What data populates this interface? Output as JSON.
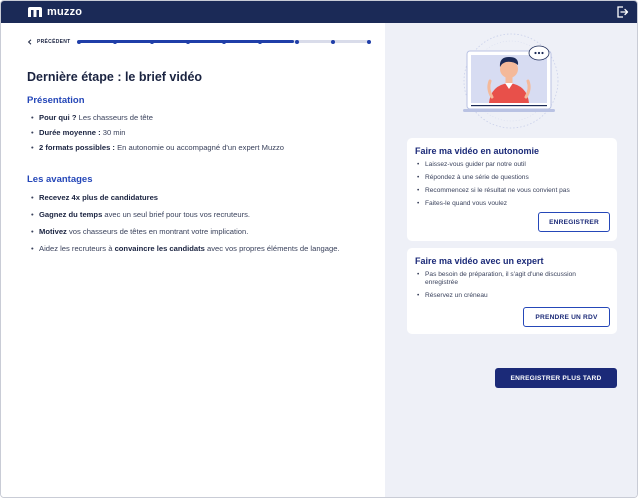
{
  "brand": {
    "name": "muzzo"
  },
  "nav": {
    "back_label": "PRÉCÉDENT"
  },
  "progress": {
    "fraction": 0.74,
    "steps": 9
  },
  "page": {
    "title": "Dernière étape : le brief vidéo"
  },
  "presentation": {
    "title": "Présentation",
    "items": [
      {
        "label": "Pour qui ?",
        "text": " Les chasseurs de tête"
      },
      {
        "label": "Durée moyenne :",
        "text": " 30 min"
      },
      {
        "label": "2 formats possibles :",
        "text": " En autonomie ou accompagné d'un expert Muzzo"
      }
    ]
  },
  "advantages": {
    "title": "Les avantages",
    "items": [
      {
        "pre": "",
        "label": "Recevez 4x plus de candidatures",
        "post": ""
      },
      {
        "pre": "",
        "label": "Gagnez du temps",
        "post": " avec un seul brief pour tous vos recruteurs."
      },
      {
        "pre": "",
        "label": "Motivez",
        "post": " vos chasseurs de têtes en montrant votre implication."
      },
      {
        "pre": "Aidez les recruteurs à ",
        "label": "convaincre les candidats",
        "post": " avec vos propres éléments de langage."
      }
    ]
  },
  "card_auto": {
    "title": "Faire ma vidéo en autonomie",
    "items": [
      "Laissez-vous guider par notre outil",
      "Répondez à une série de questions",
      "Recommencez si le résultat ne vous convient pas",
      "Faites-le quand vous voulez"
    ],
    "button": "ENREGISTRER"
  },
  "card_expert": {
    "title": "Faire ma vidéo avec un expert",
    "items": [
      "Pas besoin de préparation, il s'agit d'une discussion enregistrée",
      "Réservez un créneau"
    ],
    "button": "PRENDRE UN RDV"
  },
  "later_button": "ENREGISTRER PLUS TARD",
  "colors": {
    "navy": "#1b2a57",
    "accent": "#2547b8",
    "panel": "#eef0f7",
    "shirt": "#e8504a"
  }
}
